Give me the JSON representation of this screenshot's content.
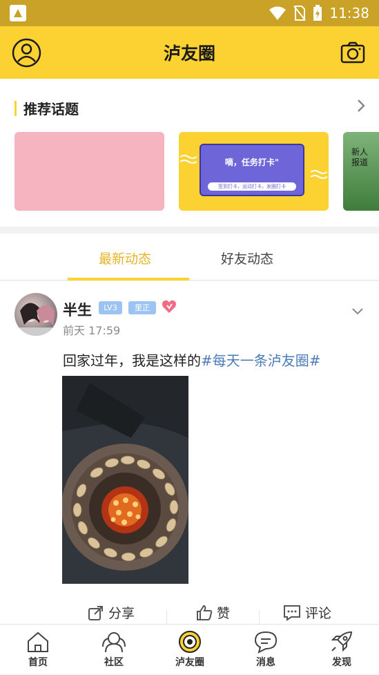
{
  "status_bar": {
    "time": "11:38"
  },
  "header": {
    "title": "泸友圈"
  },
  "topics": {
    "title": "推荐话题",
    "cards": [
      {
        "text": ""
      },
      {
        "text": "嘀，任务打卡\"",
        "subtext": "签到打卡，运动打卡，发圈打卡"
      },
      {
        "text": "新人报道"
      }
    ]
  },
  "tabs": [
    {
      "label": "最新动态",
      "active": true
    },
    {
      "label": "好友动态",
      "active": false
    }
  ],
  "post": {
    "username": "半生",
    "level": "LV3",
    "badge": "里正",
    "time": "前天 17:59",
    "text": "回家过年，我是这样的",
    "hashtag": "#每天一条泸友圈#",
    "actions": {
      "share": "分享",
      "like": "赞",
      "comment": "评论"
    }
  },
  "bottom_nav": [
    {
      "label": "首页",
      "icon": "home-icon"
    },
    {
      "label": "社区",
      "icon": "community-icon"
    },
    {
      "label": "泸友圈",
      "icon": "circle-icon",
      "active": true
    },
    {
      "label": "消息",
      "icon": "message-icon"
    },
    {
      "label": "发现",
      "icon": "rocket-icon"
    }
  ],
  "colors": {
    "accent": "#fcd233",
    "status_bar": "#c9a227",
    "active_tab": "#e8b52a",
    "hashtag": "#4a7ab8"
  }
}
